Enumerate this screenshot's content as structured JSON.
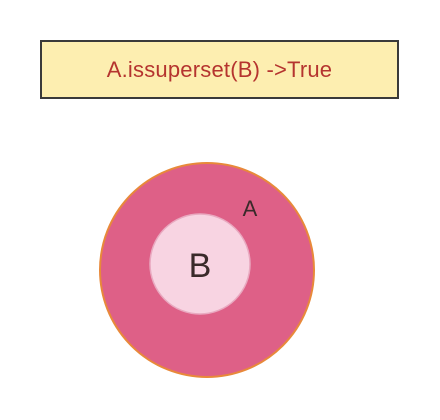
{
  "header": {
    "text": "A.issuperset(B) ->True"
  },
  "sets": {
    "outer": {
      "label": "A"
    },
    "inner": {
      "label": "B"
    }
  },
  "colors": {
    "title_bg": "#fdeeb0",
    "title_text": "#b5342f",
    "outer_fill": "#de6087",
    "outer_stroke": "#e8893a",
    "inner_fill": "#f8d4e2",
    "inner_stroke": "#e9a9c0",
    "label_text": "#3a2a2a"
  }
}
